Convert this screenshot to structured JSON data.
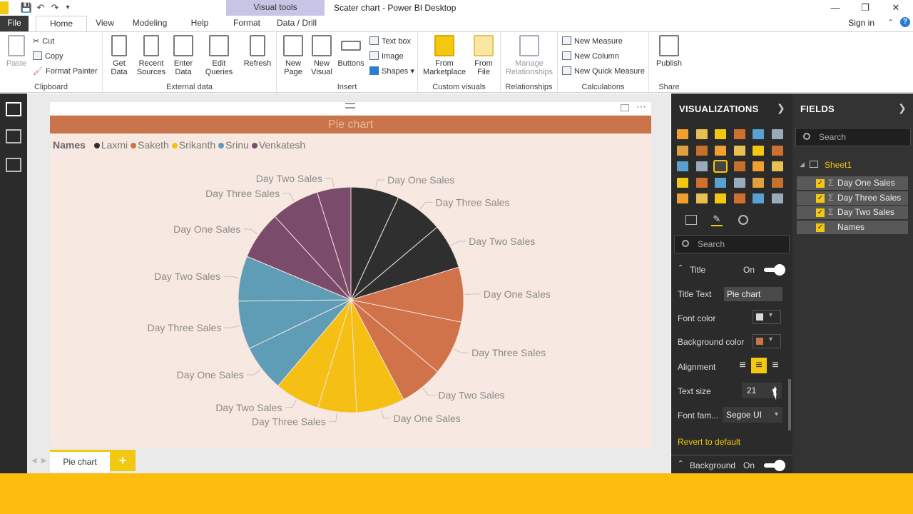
{
  "window": {
    "title": "Scater chart - Power BI Desktop",
    "context_tab_group": "Visual tools",
    "sign_in": "Sign in"
  },
  "tabs": [
    "File",
    "Home",
    "View",
    "Modeling",
    "Help",
    "Format",
    "Data / Drill"
  ],
  "ribbon": {
    "clipboard": {
      "paste": "Paste",
      "cut": "Cut",
      "copy": "Copy",
      "format_painter": "Format Painter",
      "label": "Clipboard"
    },
    "external_data": {
      "get_data": "Get Data",
      "recent_sources": "Recent Sources",
      "enter_data": "Enter Data",
      "edit_queries": "Edit Queries",
      "refresh": "Refresh",
      "label": "External data"
    },
    "insert": {
      "new_page": "New Page",
      "new_visual": "New Visual",
      "buttons": "Buttons",
      "text_box": "Text box",
      "image": "Image",
      "shapes": "Shapes",
      "label": "Insert"
    },
    "custom_visuals": {
      "from_marketplace": "From Marketplace",
      "from_file": "From File",
      "label": "Custom visuals"
    },
    "relationships": {
      "manage": "Manage Relationships",
      "label": "Relationships"
    },
    "calculations": {
      "new_measure": "New Measure",
      "new_column": "New Column",
      "new_quick_measure": "New Quick Measure",
      "label": "Calculations"
    },
    "share": {
      "publish": "Publish",
      "label": "Share"
    }
  },
  "visual": {
    "title": "Pie chart",
    "legend_title": "Names"
  },
  "chart_data": {
    "type": "pie",
    "title": "Pie chart",
    "legend_title": "Names",
    "legend_position": "top-left",
    "series": [
      {
        "name": "Laxmi",
        "color": "#2f2f2f"
      },
      {
        "name": "Saketh",
        "color": "#d0724a"
      },
      {
        "name": "Srikanth",
        "color": "#f5c013"
      },
      {
        "name": "Srinu",
        "color": "#5f9db7"
      },
      {
        "name": "Venkatesh",
        "color": "#7a4b6b"
      }
    ],
    "slices": [
      {
        "group": "Laxmi",
        "label": "Day One Sales",
        "value": 30
      },
      {
        "group": "Laxmi",
        "label": "Day Three Sales",
        "value": 30
      },
      {
        "group": "Laxmi",
        "label": "Day Two Sales",
        "value": 28
      },
      {
        "group": "Saketh",
        "label": "Day One Sales",
        "value": 34
      },
      {
        "group": "Saketh",
        "label": "Day Three Sales",
        "value": 34
      },
      {
        "group": "Saketh",
        "label": "Day Two Sales",
        "value": 27
      },
      {
        "group": "Srikanth",
        "label": "Day One Sales",
        "value": 30
      },
      {
        "group": "Srikanth",
        "label": "Day Three Sales",
        "value": 24
      },
      {
        "group": "Srikanth",
        "label": "Day Two Sales",
        "value": 28
      },
      {
        "group": "Srinu",
        "label": "Day One Sales",
        "value": 29
      },
      {
        "group": "Srinu",
        "label": "Day Three Sales",
        "value": 30
      },
      {
        "group": "Srinu",
        "label": "Day Two Sales",
        "value": 28
      },
      {
        "group": "Venkatesh",
        "label": "Day One Sales",
        "value": 30
      },
      {
        "group": "Venkatesh",
        "label": "Day Three Sales",
        "value": 30
      },
      {
        "group": "Venkatesh",
        "label": "Day Two Sales",
        "value": 21
      }
    ]
  },
  "page_tabs": {
    "active": "Pie chart",
    "add": "+"
  },
  "visualizations_pane": {
    "title": "VISUALIZATIONS",
    "search_placeholder": "Search",
    "title_section": {
      "label": "Title",
      "state": "On"
    },
    "title_text": {
      "label": "Title Text",
      "value": "Pie chart"
    },
    "font_color": {
      "label": "Font color",
      "value": "#d9d9d9"
    },
    "background_color": {
      "label": "Background color",
      "value": "#c9744a"
    },
    "alignment": {
      "label": "Alignment",
      "selected": "center"
    },
    "text_size": {
      "label": "Text size",
      "value": "21"
    },
    "font_family": {
      "label": "Font fam...",
      "value": "Segoe UI"
    },
    "revert": "Revert to default",
    "background_section": {
      "label": "Background",
      "state": "On"
    }
  },
  "fields_pane": {
    "title": "FIELDS",
    "search_placeholder": "Search",
    "table": "Sheet1",
    "fields": [
      "Day One Sales",
      "Day Three Sales",
      "Day Two Sales",
      "Names"
    ]
  }
}
